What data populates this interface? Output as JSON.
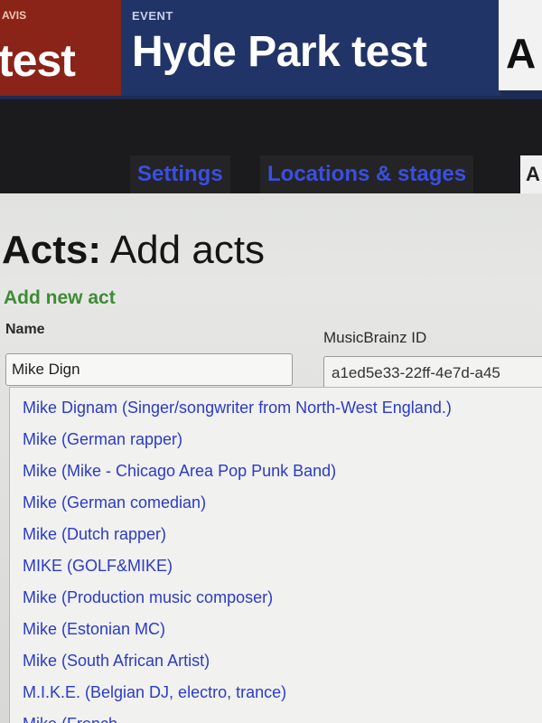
{
  "header": {
    "prev_crumb_small": "AVIS",
    "prev_crumb_title": "test",
    "event_label": "EVENT",
    "event_title": "Hyde Park test",
    "next_crumb_title": "A"
  },
  "subnav": {
    "tabs": [
      {
        "label": "Settings"
      },
      {
        "label": "Locations & stages"
      }
    ],
    "next_tab_partial": "A"
  },
  "main": {
    "title_bold": "Acts:",
    "title_rest": " Add acts",
    "section_heading": "Add new act",
    "name_label": "Name",
    "name_value": "Mike Dign",
    "mbid_label": "MusicBrainz ID",
    "mbid_value": "a1ed5e33-22ff-4e7d-a45"
  },
  "autocomplete": {
    "items": [
      "Mike Dignam (Singer/songwriter from North-West England.)",
      "Mike (German rapper)",
      "Mike (Mike - Chicago Area Pop Punk Band)",
      "Mike (German comedian)",
      "Mike (Dutch rapper)",
      "MIKE (GOLF&MIKE)",
      "Mike (Production music composer)",
      "Mike (Estonian MC)",
      "Mike (South African Artist)",
      "M.I.K.E. (Belgian DJ, electro, trance)",
      "Mike (French"
    ]
  },
  "colors": {
    "header_event_bg": "#213468",
    "header_prev_bg": "#8a2318",
    "subnav_bg": "#1b1b1d",
    "tab_text": "#3a4fe0",
    "section_heading": "#3f8b34",
    "link_blue": "#2b3bc8"
  }
}
